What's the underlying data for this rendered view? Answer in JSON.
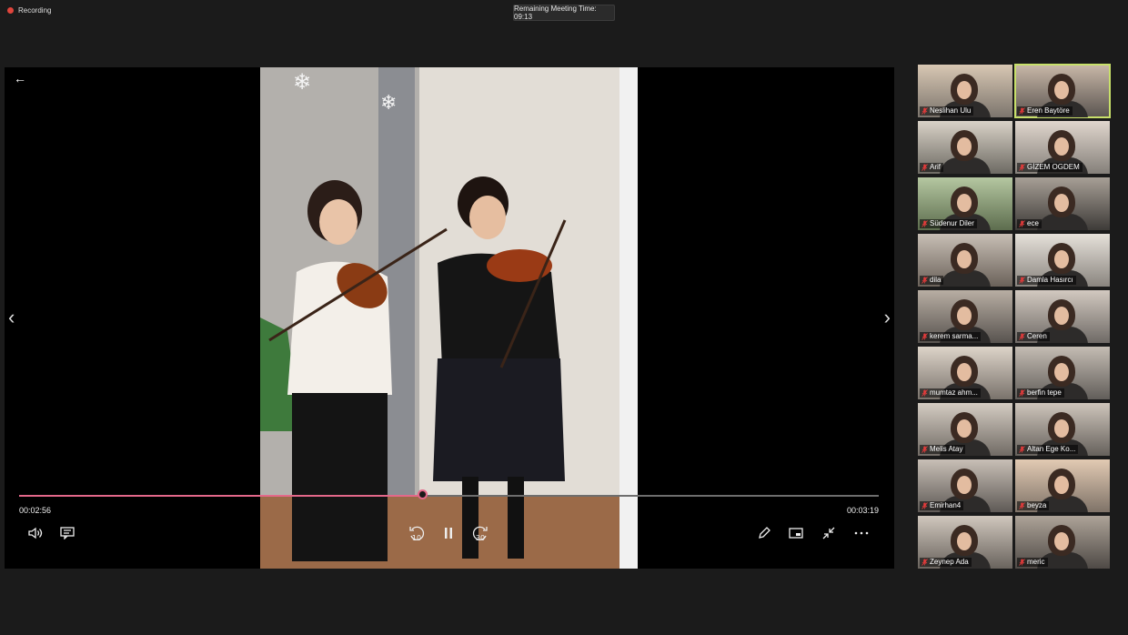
{
  "top": {
    "recording_label": "Recording",
    "timer_label": "Remaining Meeting Time: 09:13"
  },
  "player": {
    "current_time": "00:02:56",
    "total_time": "00:03:19",
    "progress": 0.47,
    "skip_back_label": "10",
    "skip_forward_label": "30",
    "accent_color": "#e4688a",
    "icons": [
      "back-arrow-icon",
      "prev-chevron-icon",
      "next-chevron-icon",
      "volume-icon",
      "captions-icon",
      "rewind-10-icon",
      "pause-icon",
      "forward-30-icon",
      "pen-icon",
      "miniplayer-icon",
      "exit-fullscreen-icon",
      "more-icon"
    ]
  },
  "participants": [
    {
      "name": "Neslihan Ulu"
    },
    {
      "name": "Eren Baytöre",
      "active": true
    },
    {
      "name": "Arif"
    },
    {
      "name": "GİZEM OGDEM"
    },
    {
      "name": "Südenur Diler"
    },
    {
      "name": "ece"
    },
    {
      "name": "dila"
    },
    {
      "name": "Damla Hasırcı"
    },
    {
      "name": "kerem sarma..."
    },
    {
      "name": "Ceren"
    },
    {
      "name": "mumtaz ahm..."
    },
    {
      "name": "berfin tepe"
    },
    {
      "name": "Melis Atay"
    },
    {
      "name": "Altan Ege Ko..."
    },
    {
      "name": "Emirhan4"
    },
    {
      "name": "beyza"
    },
    {
      "name": "Zeynep Ada"
    },
    {
      "name": "meric"
    }
  ]
}
